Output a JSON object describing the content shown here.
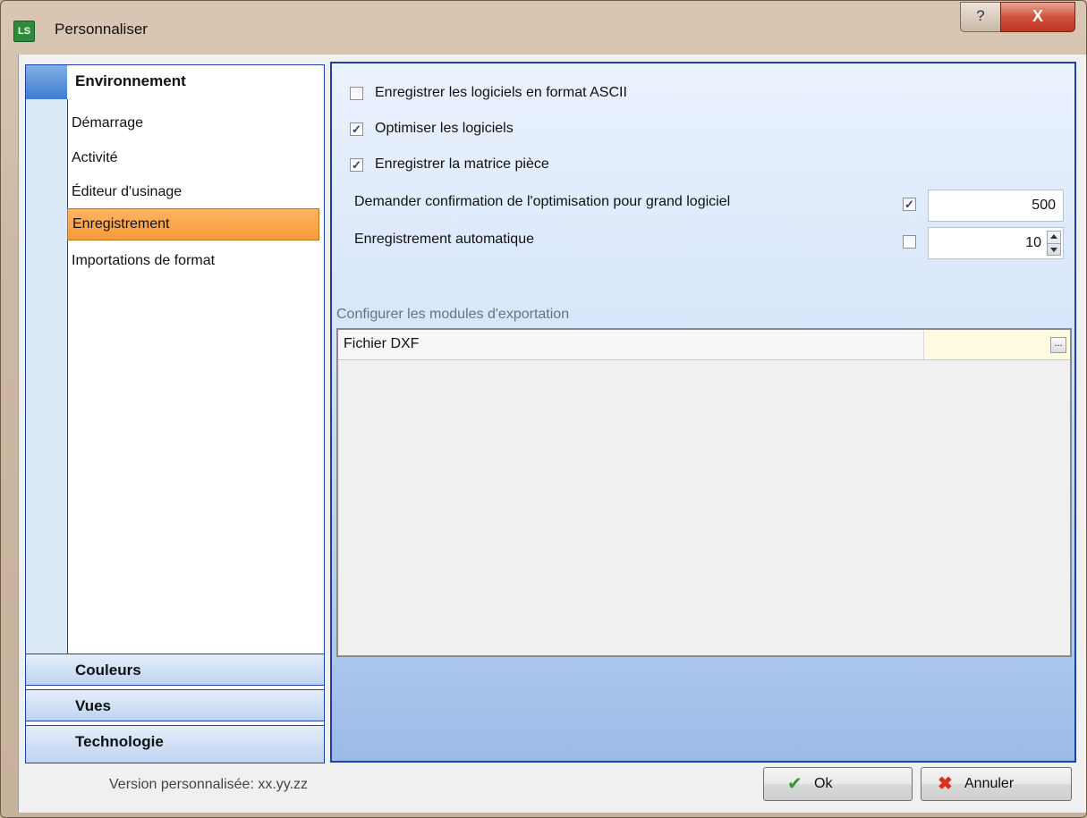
{
  "window": {
    "title": "Personnaliser",
    "app_icon_text": "LS",
    "help_button": "?",
    "close_button": "X"
  },
  "nav": {
    "active_group": "Environnement",
    "items": [
      {
        "label": "Démarrage",
        "selected": false
      },
      {
        "label": "Activité",
        "selected": false
      },
      {
        "label": "Éditeur d'usinage",
        "selected": false
      },
      {
        "label": "Enregistrement",
        "selected": true
      },
      {
        "label": "Importations de format",
        "selected": false
      }
    ],
    "other_groups": [
      "Couleurs",
      "Vues",
      "Technologie"
    ]
  },
  "options": {
    "ascii": {
      "label": "Enregistrer les logiciels en format ASCII",
      "checked": false
    },
    "optimize": {
      "label": "Optimiser les logiciels",
      "checked": true
    },
    "matrix": {
      "label": "Enregistrer la matrice pièce",
      "checked": true
    },
    "confirm_optimization": {
      "label": "Demander confirmation de l'optimisation pour grand logiciel",
      "checked": true,
      "value": "500"
    },
    "autosave": {
      "label": "Enregistrement automatique",
      "checked": false,
      "value": "10"
    }
  },
  "export": {
    "section_label": "Configurer les modules d'exportation",
    "rows": [
      {
        "name": "Fichier DXF",
        "value": "",
        "button": "..."
      }
    ]
  },
  "footer": {
    "version": "Version personnalisée: xx.yy.zz",
    "ok_label": "Ok",
    "cancel_label": "Annuler"
  }
}
